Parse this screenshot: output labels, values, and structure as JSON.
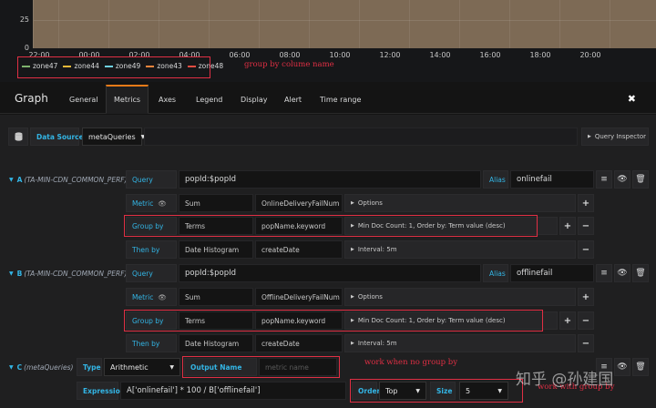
{
  "chart": {
    "y_ticks": [
      "25",
      "0"
    ],
    "x_ticks": [
      "22:00",
      "00:00",
      "02:00",
      "04:00",
      "06:00",
      "08:00",
      "10:00",
      "12:00",
      "14:00",
      "16:00",
      "18:00",
      "20:00"
    ],
    "legend": [
      {
        "name": "zone47",
        "color": "#7eb26d"
      },
      {
        "name": "zone44",
        "color": "#eab839"
      },
      {
        "name": "zone49",
        "color": "#6ed0e0"
      },
      {
        "name": "zone43",
        "color": "#ef843c"
      },
      {
        "name": "zone48",
        "color": "#e24d42"
      }
    ],
    "annotation": "group by colume name"
  },
  "panel": {
    "title": "Graph",
    "tabs": [
      "General",
      "Metrics",
      "Axes",
      "Legend",
      "Display",
      "Alert",
      "Time range"
    ],
    "active_tab": "Metrics",
    "close": "✖"
  },
  "datasource": {
    "label": "Data Source",
    "value": "metaQueries",
    "inspector": "Query Inspector"
  },
  "query_a": {
    "ref": "A",
    "source": "(TA-MIN-CDN_COMMON_PERF)",
    "query_label": "Query",
    "query": "popId:$popId",
    "alias_label": "Alias",
    "alias": "onlinefail",
    "metric_label": "Metric",
    "metric_type": "Sum",
    "metric_field": "OnlineDeliveryFailNum",
    "metric_options": "Options",
    "groupby_label": "Group by",
    "groupby_type": "Terms",
    "groupby_field": "popName.keyword",
    "groupby_options": "Min Doc Count: 1, Order by: Term value (desc)",
    "thenby_label": "Then by",
    "thenby_type": "Date Histogram",
    "thenby_field": "createDate",
    "thenby_options": "Interval: 5m"
  },
  "query_b": {
    "ref": "B",
    "source": "(TA-MIN-CDN_COMMON_PERF)",
    "query_label": "Query",
    "query": "popId:$popId",
    "alias_label": "Alias",
    "alias": "offlinefail",
    "metric_label": "Metric",
    "metric_type": "Sum",
    "metric_field": "OfflineDeliveryFailNum",
    "metric_options": "Options",
    "groupby_label": "Group by",
    "groupby_type": "Terms",
    "groupby_field": "popName.keyword",
    "groupby_options": "Min Doc Count: 1, Order by: Term value (desc)",
    "thenby_label": "Then by",
    "thenby_type": "Date Histogram",
    "thenby_field": "createDate",
    "thenby_options": "Interval: 5m"
  },
  "query_c": {
    "ref": "C",
    "source": "(metaQueries)",
    "type_label": "Type",
    "type_value": "Arithmetic",
    "output_label": "Output Name",
    "output_placeholder": "metric name",
    "expression_label": "Expression",
    "expression": "A['onlinefail'] * 100 / B['offlinefail']",
    "order_label": "Order",
    "order_value": "Top",
    "size_label": "Size",
    "size_value": "5"
  },
  "annotations": {
    "no_group": "work when no group by",
    "with_group": "work with group by"
  },
  "watermark": "知乎 @孙建国"
}
